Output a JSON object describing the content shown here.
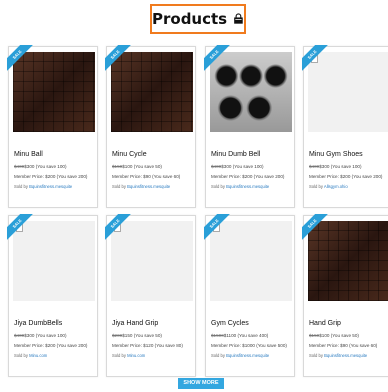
{
  "header": {
    "title": "Products",
    "icon": "shopping-bag-icon"
  },
  "products": [
    {
      "name": "Minu Ball",
      "old_price": "$400",
      "price": "$300",
      "save": "(You save 100)",
      "member_label": "Member Price:",
      "member_price": "$200",
      "member_save": "(You save 200)",
      "sold_prefix": "Sold by",
      "seller": "Bquinsfitness.mesquite",
      "image": "tiles"
    },
    {
      "name": "Minu Cycle",
      "old_price": "$150",
      "price": "$100",
      "save": "(You save 50)",
      "member_label": "Member Price:",
      "member_price": "$90",
      "member_save": "(You save 60)",
      "sold_prefix": "Sold by",
      "seller": "Bquinsfitness.mesquite",
      "image": "tiles"
    },
    {
      "name": "Minu Dumb Bell",
      "old_price": "$400",
      "price": "$300",
      "save": "(You save 100)",
      "member_label": "Member Price:",
      "member_price": "$200",
      "member_save": "(You save 200)",
      "sold_prefix": "Sold by",
      "seller": "Bquinsfitness.mesquite",
      "image": "dumbbells"
    },
    {
      "name": "Minu Gym Shoes",
      "old_price": "$400",
      "price": "$300",
      "save": "(You save 100)",
      "member_label": "Member Price:",
      "member_price": "$200",
      "member_save": "(You save 200)",
      "sold_prefix": "Sold by",
      "seller": "Allsgym.ohio",
      "image": "broken"
    },
    {
      "name": "Jiya DumbBells",
      "old_price": "$400",
      "price": "$300",
      "save": "(You save 100)",
      "member_label": "Member Price:",
      "member_price": "$200",
      "member_save": "(You save 200)",
      "sold_prefix": "Sold by",
      "seller": "Minu.com",
      "image": "broken"
    },
    {
      "name": "Jiya Hand Grip",
      "old_price": "$200",
      "price": "$150",
      "save": "(You save 50)",
      "member_label": "Member Price:",
      "member_price": "$120",
      "member_save": "(You save 80)",
      "sold_prefix": "Sold by",
      "seller": "Minu.com",
      "image": "broken"
    },
    {
      "name": "Gym Cycles",
      "old_price": "$1500",
      "price": "$1100",
      "save": "(You save 400)",
      "member_label": "Member Price:",
      "member_price": "$1000",
      "member_save": "(You save 500)",
      "sold_prefix": "Sold by",
      "seller": "Bquinsfitness.mesquite",
      "image": "broken"
    },
    {
      "name": "Hand Grip",
      "old_price": "$150",
      "price": "$100",
      "save": "(You save 50)",
      "member_label": "Member Price:",
      "member_price": "$90",
      "member_save": "(You save 60)",
      "sold_prefix": "Sold by",
      "seller": "Bquinsfitness.mesquite",
      "image": "tiles"
    }
  ],
  "badge_label": "SALE",
  "show_more_label": "SHOW MORE",
  "colors": {
    "accent": "#33a7e0",
    "title_border": "#f07b1e",
    "ribbon": "#2a9fd8"
  }
}
